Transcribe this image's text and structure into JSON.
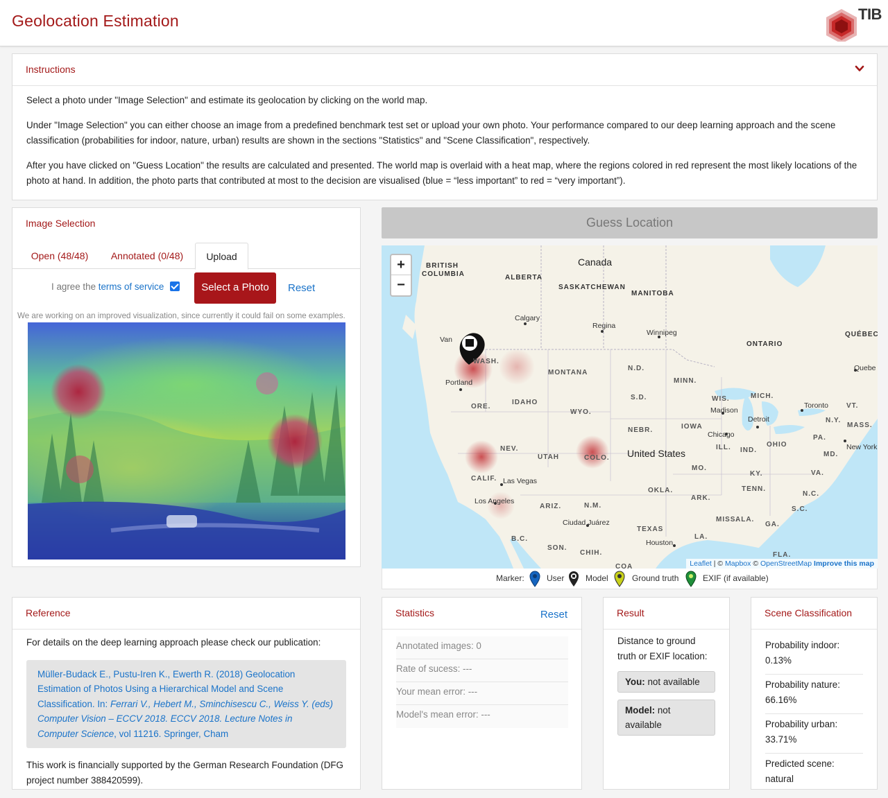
{
  "header": {
    "title": "Geolocation Estimation",
    "logo_text": "TIB"
  },
  "instructions": {
    "title": "Instructions",
    "paragraphs": [
      "Select a photo under \"Image Selection\" and estimate its geolocation by clicking on the world map.",
      "Under \"Image Selection\" you can either choose an image from a predefined benchmark test set or upload your own photo. Your performance compared to our deep learning approach and the scene classification (probabilities for indoor, nature, urban) results are shown in the sections \"Statistics\" and \"Scene Classification\", respectively.",
      "After you have clicked on \"Guess Location\" the results are calculated and presented. The world map is overlaid with a heat map, where the regions colored in red represent the most likely locations of the photo at hand. In addition, the photo parts that contributed at most to the decision are visualised (blue = “less important” to red = “very important”)."
    ]
  },
  "image_selection": {
    "title": "Image Selection",
    "tabs": [
      "Open (48/48)",
      "Annotated (0/48)",
      "Upload"
    ],
    "active_tab": "Upload",
    "agree_prefix": "I agree the",
    "terms_link": "terms of service",
    "agree_checked": true,
    "select_button": "Select a Photo",
    "reset": "Reset",
    "note": "We are working on an improved visualization, since currently it could fail on some examples."
  },
  "guess_button": "Guess Location",
  "map": {
    "zoom_in": "+",
    "zoom_out": "−",
    "labels": {
      "canada": "Canada",
      "british_columbia_1": "BRITISH",
      "british_columbia_2": "COLUMBIA",
      "alberta": "ALBERTA",
      "saskatchewan": "SASKATCHEWAN",
      "manitoba": "MANITOBA",
      "ontario": "ONTARIO",
      "quebec": "QUÉBEC",
      "calgary": "Calgary",
      "regina": "Regina",
      "winnipeg": "Winnipeg",
      "vancouver": "Van",
      "wash": "WASH.",
      "portland": "Portland",
      "montana": "MONTANA",
      "nd": "N.D.",
      "minn": "MINN.",
      "ore": "ORE.",
      "idaho": "IDAHO",
      "wyo": "WYO.",
      "sd": "S.D.",
      "wis": "WIS.",
      "mich": "MICH.",
      "madison": "Madison",
      "detroit": "Detroit",
      "toronto": "Toronto",
      "vt": "VT.",
      "ny": "N.Y.",
      "mass": "MASS.",
      "quebec_city": "Quebe",
      "nebr": "NEBR.",
      "iowa": "IOWA",
      "chicago": "Chicago",
      "ohio": "OHIO",
      "pa": "PA.",
      "new_york": "New York",
      "nev": "NEV.",
      "utah": "UTAH",
      "colo": "COLO.",
      "united_states": "United States",
      "ill": "ILL.",
      "ind": "IND.",
      "md": "MD.",
      "mo": "MO.",
      "ky": "KY.",
      "va": "VA.",
      "calif": "CALIF.",
      "las_vegas": "Las Vegas",
      "okla": "OKLA.",
      "tenn": "TENN.",
      "nc": "N.C.",
      "los_angeles": "Los Angeles",
      "ariz": "ARIZ.",
      "nm": "N.M.",
      "ark": "ARK.",
      "sc": "S.C.",
      "ciudad_juarez": "Ciudad Juárez",
      "miss": "MISS.",
      "ala": "ALA.",
      "ga": "GA.",
      "texas": "TEXAS",
      "bc": "B.C.",
      "houston": "Houston",
      "la": "LA.",
      "son": "SON.",
      "chih": "CHIH.",
      "coa": "COA",
      "fla": "FLA."
    },
    "attribution": {
      "leaflet": "Leaflet",
      "sep1": " | © ",
      "mapbox": "Mapbox",
      "sep2": " © ",
      "osm": "OpenStreetMap",
      "improve": "Improve this map"
    }
  },
  "legend": {
    "label": "Marker:",
    "items": [
      {
        "name": "User",
        "color": "#1565c0"
      },
      {
        "name": "Model",
        "color": "#222222"
      },
      {
        "name": "Ground truth",
        "color": "#c9d21a"
      },
      {
        "name": "EXIF (if available)",
        "color": "#1f8f3a"
      }
    ]
  },
  "reference": {
    "title": "Reference",
    "intro": "For details on the deep learning approach please check our publication:",
    "citation_plain": "Müller-Budack E., Pustu-Iren K., Ewerth R. (2018) Geolocation Estimation of Photos Using a Hierarchical Model and Scene Classification. In: ",
    "citation_italic": "Ferrari V., Hebert M., Sminchisescu C., Weiss Y. (eds) Computer Vision – ECCV 2018. ECCV 2018. Lecture Notes in Computer Science",
    "citation_tail": ", vol 11216. Springer, Cham",
    "funding": "This work is financially supported by the German Research Foundation (DFG project number 388420599)."
  },
  "statistics": {
    "title": "Statistics",
    "reset": "Reset",
    "rows": [
      "Annotated images: 0",
      "Rate of sucess: ---",
      "Your mean error: ---",
      "Model's mean error: ---"
    ]
  },
  "result": {
    "title": "Result",
    "intro": "Distance to ground truth or EXIF location:",
    "you_label": "You:",
    "you_value": " not available",
    "model_label": "Model:",
    "model_value": " not available"
  },
  "scene": {
    "title": "Scene Classification",
    "rows": [
      {
        "label": "Probability indoor:",
        "value": "0.13%"
      },
      {
        "label": "Probability nature:",
        "value": "66.16%"
      },
      {
        "label": "Probability urban:",
        "value": "33.71%"
      },
      {
        "label": "Predicted scene:",
        "value": "natural"
      }
    ]
  }
}
